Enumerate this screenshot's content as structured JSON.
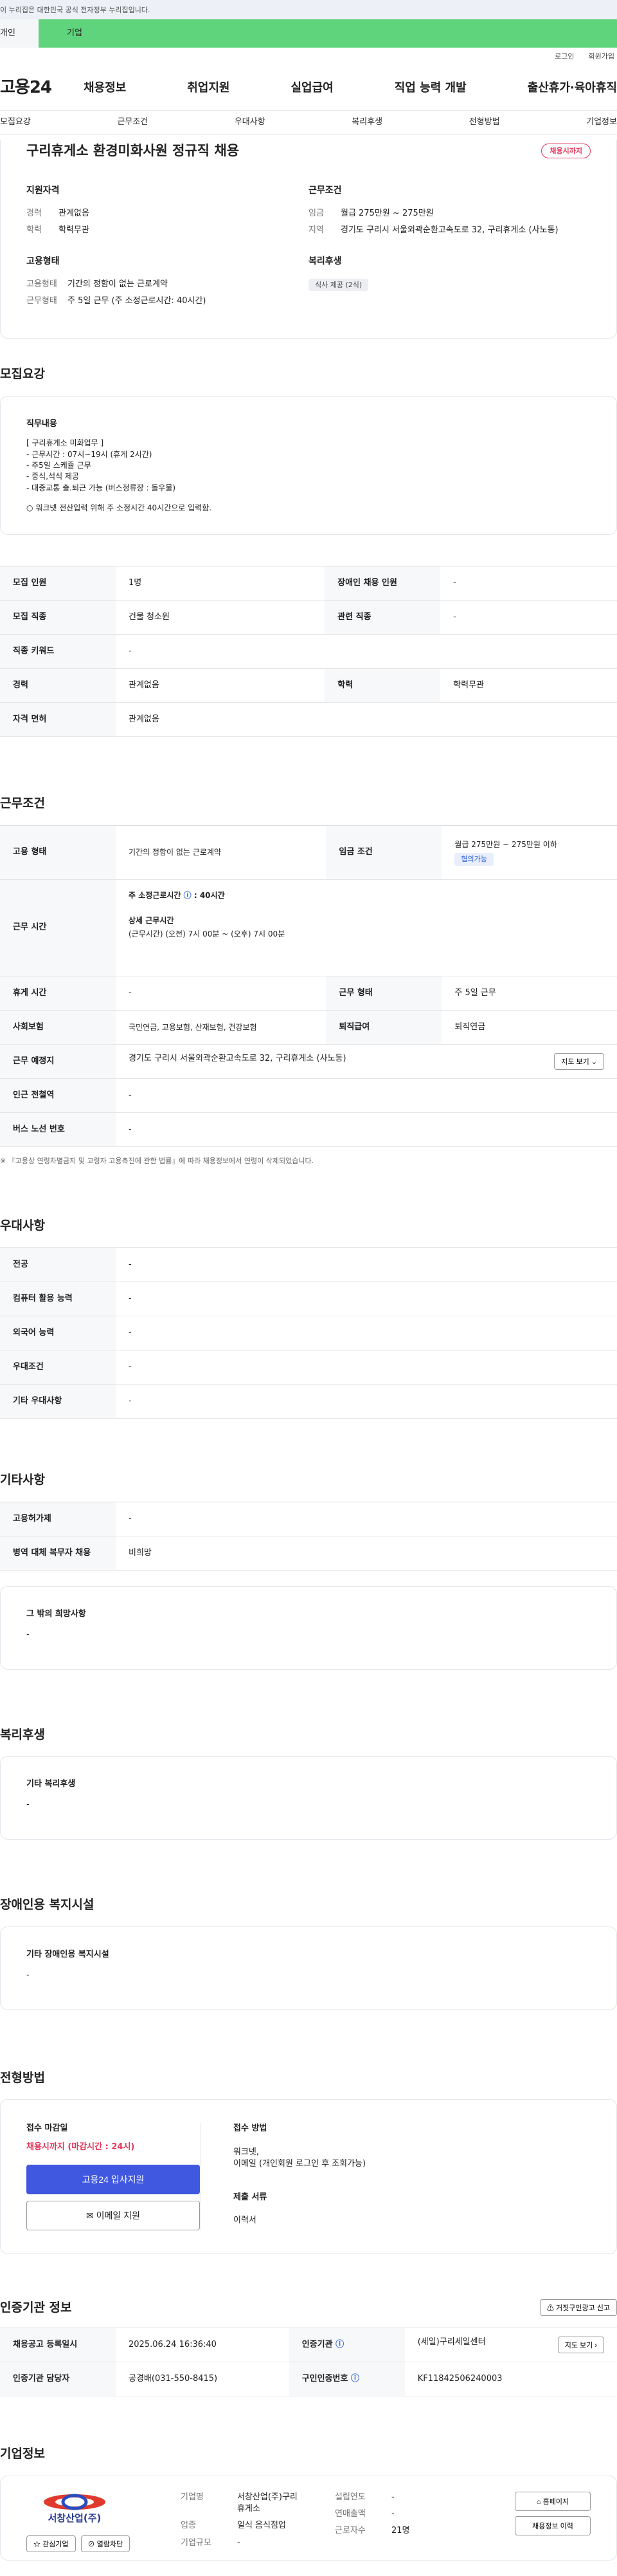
{
  "topbar": {
    "notice": "이 누리집은 대한민국 공식 전자정부 누리집입니다."
  },
  "tabs": {
    "first": "개인",
    "second": "기업"
  },
  "util": {
    "login": "로그인",
    "signup": "회원가입"
  },
  "gnb": {
    "logo": "고용24",
    "items": [
      "채용정보",
      "취업지원",
      "실업급여",
      "직업 능력 개발",
      "출산휴가·육아휴직"
    ]
  },
  "subnav": [
    "모집요강",
    "근무조건",
    "우대사항",
    "복리후생",
    "전형방법",
    "기업정보"
  ],
  "header": {
    "title": "구리휴게소 환경미화사원 정규직 채용",
    "badge": "채용시까지",
    "qualification": {
      "heading": "지원자격",
      "career_k": "경력",
      "career_v": "관계없음",
      "edu_k": "학력",
      "edu_v": "학력무관"
    },
    "conditions": {
      "heading": "근무조건",
      "wage_k": "임금",
      "wage_v": "월급 275만원 ~ 275만원",
      "loc_k": "지역",
      "loc_v": "경기도 구리시 서울외곽순환고속도로 32, 구리휴게소 (사노동)"
    },
    "employment": {
      "heading": "고용형태",
      "type_k": "고용형태",
      "type_v": "기간의 정함이 없는 근로계약",
      "form_k": "근무형태",
      "form_v": "주 5일 근무 (주 소정근로시간: 40시간)"
    },
    "welfare": {
      "heading": "복리후생",
      "tag": "식사 제공 (2식)"
    }
  },
  "recruit": {
    "title": "모집요강",
    "duty_heading": "직무내용",
    "duty_lines": [
      "[ 구리휴게소 미화업무 ]",
      "- 근무시간 : 07시~19시 (휴게 2시간)",
      "- 주5일 스케쥴 근무",
      "- 중식,석식 제공",
      "- 대중교통 출.퇴근 가능 (버스정류장 : 돌우물)"
    ],
    "duty_note": "○ 워크넷 전산입력 위해 주 소정시간 40시간으로 입력함.",
    "rows": [
      [
        "모집 인원",
        "1명",
        "장애인 채용 인원",
        "-"
      ],
      [
        "모집 직종",
        "건물 청소원",
        "관련 직종",
        "-"
      ],
      [
        "직종 키워드",
        "-"
      ],
      [
        "경력",
        "관계없음",
        "학력",
        "학력무관"
      ],
      [
        "자격 면허",
        "관계없음"
      ]
    ]
  },
  "work": {
    "title": "근무조건",
    "emp_k": "고용 형태",
    "emp_v": "기간의 정함이 없는 근로계약",
    "wage_k": "임금 조건",
    "wage_v": "월급 275만원 ~ 275만원 이하",
    "wage_tag": "협의가능",
    "time_k": "근무 시간",
    "weekly_label": "주 소정근로시간",
    "weekly_val": "40시간",
    "detail_label": "상세 근무시간",
    "detail_val": "(근무시간) (오전) 7시 00분 ~ (오후) 7시 00분",
    "rows": [
      [
        "휴게 시간",
        "-",
        "근무 형태",
        "주 5일 근무"
      ],
      [
        "사회보험",
        "국민연금, 고용보험, 산재보험, 건강보험",
        "퇴직급여",
        "퇴직연금"
      ]
    ],
    "place_k": "근무 예정지",
    "place_v": "경기도 구리시 서울외곽순환고속도로 32, 구리휴게소 (사노동)",
    "map_btn": "지도 보기",
    "subway_k": "인근 전철역",
    "subway_v": "-",
    "bus_k": "버스 노선 번호",
    "bus_v": "-",
    "note": "※ 『고용상 연령차별금지 및 고령자 고용촉진에 관한 법률』에 따라 채용정보에서 연령이 삭제되었습니다."
  },
  "pref": {
    "title": "우대사항",
    "rows": [
      [
        "전공",
        "-"
      ],
      [
        "컴퓨터 활용 능력",
        "-"
      ],
      [
        "외국어 능력",
        "-"
      ],
      [
        "우대조건",
        "-"
      ],
      [
        "기타 우대사항",
        "-"
      ]
    ]
  },
  "etc": {
    "title": "기타사항",
    "rows": [
      [
        "고용허가제",
        "-"
      ],
      [
        "병역 대체 복무자 채용",
        "비희망"
      ]
    ],
    "box_heading": "그 밖의 희망사항",
    "box_val": "-"
  },
  "welfare": {
    "title": "복리후생",
    "box_heading": "기타 복리후생",
    "box_val": "-"
  },
  "disab": {
    "title": "장애인용 복지시설",
    "box_heading": "기타 장애인용 복지시설",
    "box_val": "-"
  },
  "apply": {
    "title": "전형방법",
    "deadline_label": "접수 마감일",
    "deadline_val": "채용시까지 (마감시간 : 24시)",
    "btn_apply": "고용24 입사지원",
    "btn_email": "이메일 지원",
    "method_label": "접수 방법",
    "method_line1": "워크넷,",
    "method_line2": "이메일 (개인회원 로그인 후 조회가능)",
    "docs_label": "제출 서류",
    "docs_val": "이력서"
  },
  "cert": {
    "title": "인증기관 정보",
    "report_btn": "거짓구인광고 신고",
    "r1": [
      "채용공고 등록일시",
      "2025.06.24 16:36:40",
      "인증기관",
      "(세일)구리세일센터",
      "지도 보기"
    ],
    "r2": [
      "인증기관 담당자",
      "공경배(031-550-8415)",
      "구인인증번호",
      "KF11842506240003"
    ]
  },
  "company": {
    "title": "기업정보",
    "logo_text": "서창산업(주)",
    "btn_fav": "관심기업",
    "btn_block": "열람차단",
    "name_k": "기업명",
    "name_v1": "서창산업(주)구리",
    "name_v2": "휴게소",
    "ind_k": "업종",
    "ind_v": "일식 음식점업",
    "size_k": "기업규모",
    "size_v": "-",
    "found_k": "설립연도",
    "found_v": "-",
    "sales_k": "연매출액",
    "sales_v": "-",
    "emp_k": "근로자수",
    "emp_v": "21명",
    "btn_home": "홈페이지",
    "btn_jobs": "채용정보 이력"
  }
}
